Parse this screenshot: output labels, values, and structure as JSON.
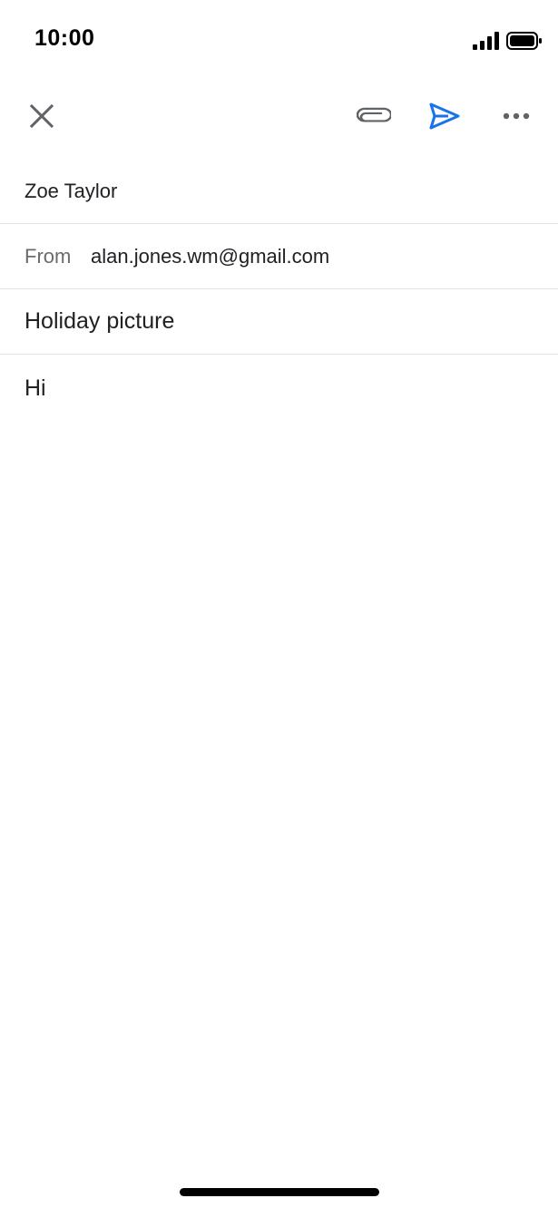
{
  "status_bar": {
    "time": "10:00",
    "signal_icon": "cellular-signal-icon",
    "battery_icon": "battery-full-icon"
  },
  "toolbar": {
    "close_icon": "close-icon",
    "attach_icon": "paperclip-icon",
    "send_icon": "send-icon",
    "more_icon": "more-horizontal-icon",
    "accent_color": "#1a73e8"
  },
  "compose": {
    "to_value": "Zoe Taylor",
    "from_label": "From",
    "from_value": "alan.jones.wm@gmail.com",
    "subject": "Holiday picture",
    "body": "Hi"
  }
}
